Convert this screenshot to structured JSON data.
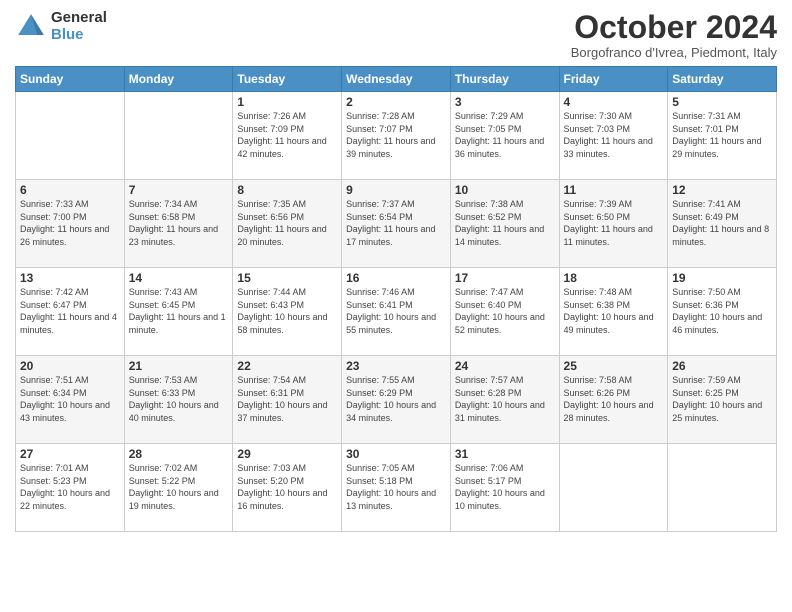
{
  "header": {
    "logo_general": "General",
    "logo_blue": "Blue",
    "month_title": "October 2024",
    "location": "Borgofranco d'Ivrea, Piedmont, Italy"
  },
  "weekdays": [
    "Sunday",
    "Monday",
    "Tuesday",
    "Wednesday",
    "Thursday",
    "Friday",
    "Saturday"
  ],
  "weeks": [
    [
      {
        "day": "",
        "sunrise": "",
        "sunset": "",
        "daylight": ""
      },
      {
        "day": "",
        "sunrise": "",
        "sunset": "",
        "daylight": ""
      },
      {
        "day": "1",
        "sunrise": "Sunrise: 7:26 AM",
        "sunset": "Sunset: 7:09 PM",
        "daylight": "Daylight: 11 hours and 42 minutes."
      },
      {
        "day": "2",
        "sunrise": "Sunrise: 7:28 AM",
        "sunset": "Sunset: 7:07 PM",
        "daylight": "Daylight: 11 hours and 39 minutes."
      },
      {
        "day": "3",
        "sunrise": "Sunrise: 7:29 AM",
        "sunset": "Sunset: 7:05 PM",
        "daylight": "Daylight: 11 hours and 36 minutes."
      },
      {
        "day": "4",
        "sunrise": "Sunrise: 7:30 AM",
        "sunset": "Sunset: 7:03 PM",
        "daylight": "Daylight: 11 hours and 33 minutes."
      },
      {
        "day": "5",
        "sunrise": "Sunrise: 7:31 AM",
        "sunset": "Sunset: 7:01 PM",
        "daylight": "Daylight: 11 hours and 29 minutes."
      }
    ],
    [
      {
        "day": "6",
        "sunrise": "Sunrise: 7:33 AM",
        "sunset": "Sunset: 7:00 PM",
        "daylight": "Daylight: 11 hours and 26 minutes."
      },
      {
        "day": "7",
        "sunrise": "Sunrise: 7:34 AM",
        "sunset": "Sunset: 6:58 PM",
        "daylight": "Daylight: 11 hours and 23 minutes."
      },
      {
        "day": "8",
        "sunrise": "Sunrise: 7:35 AM",
        "sunset": "Sunset: 6:56 PM",
        "daylight": "Daylight: 11 hours and 20 minutes."
      },
      {
        "day": "9",
        "sunrise": "Sunrise: 7:37 AM",
        "sunset": "Sunset: 6:54 PM",
        "daylight": "Daylight: 11 hours and 17 minutes."
      },
      {
        "day": "10",
        "sunrise": "Sunrise: 7:38 AM",
        "sunset": "Sunset: 6:52 PM",
        "daylight": "Daylight: 11 hours and 14 minutes."
      },
      {
        "day": "11",
        "sunrise": "Sunrise: 7:39 AM",
        "sunset": "Sunset: 6:50 PM",
        "daylight": "Daylight: 11 hours and 11 minutes."
      },
      {
        "day": "12",
        "sunrise": "Sunrise: 7:41 AM",
        "sunset": "Sunset: 6:49 PM",
        "daylight": "Daylight: 11 hours and 8 minutes."
      }
    ],
    [
      {
        "day": "13",
        "sunrise": "Sunrise: 7:42 AM",
        "sunset": "Sunset: 6:47 PM",
        "daylight": "Daylight: 11 hours and 4 minutes."
      },
      {
        "day": "14",
        "sunrise": "Sunrise: 7:43 AM",
        "sunset": "Sunset: 6:45 PM",
        "daylight": "Daylight: 11 hours and 1 minute."
      },
      {
        "day": "15",
        "sunrise": "Sunrise: 7:44 AM",
        "sunset": "Sunset: 6:43 PM",
        "daylight": "Daylight: 10 hours and 58 minutes."
      },
      {
        "day": "16",
        "sunrise": "Sunrise: 7:46 AM",
        "sunset": "Sunset: 6:41 PM",
        "daylight": "Daylight: 10 hours and 55 minutes."
      },
      {
        "day": "17",
        "sunrise": "Sunrise: 7:47 AM",
        "sunset": "Sunset: 6:40 PM",
        "daylight": "Daylight: 10 hours and 52 minutes."
      },
      {
        "day": "18",
        "sunrise": "Sunrise: 7:48 AM",
        "sunset": "Sunset: 6:38 PM",
        "daylight": "Daylight: 10 hours and 49 minutes."
      },
      {
        "day": "19",
        "sunrise": "Sunrise: 7:50 AM",
        "sunset": "Sunset: 6:36 PM",
        "daylight": "Daylight: 10 hours and 46 minutes."
      }
    ],
    [
      {
        "day": "20",
        "sunrise": "Sunrise: 7:51 AM",
        "sunset": "Sunset: 6:34 PM",
        "daylight": "Daylight: 10 hours and 43 minutes."
      },
      {
        "day": "21",
        "sunrise": "Sunrise: 7:53 AM",
        "sunset": "Sunset: 6:33 PM",
        "daylight": "Daylight: 10 hours and 40 minutes."
      },
      {
        "day": "22",
        "sunrise": "Sunrise: 7:54 AM",
        "sunset": "Sunset: 6:31 PM",
        "daylight": "Daylight: 10 hours and 37 minutes."
      },
      {
        "day": "23",
        "sunrise": "Sunrise: 7:55 AM",
        "sunset": "Sunset: 6:29 PM",
        "daylight": "Daylight: 10 hours and 34 minutes."
      },
      {
        "day": "24",
        "sunrise": "Sunrise: 7:57 AM",
        "sunset": "Sunset: 6:28 PM",
        "daylight": "Daylight: 10 hours and 31 minutes."
      },
      {
        "day": "25",
        "sunrise": "Sunrise: 7:58 AM",
        "sunset": "Sunset: 6:26 PM",
        "daylight": "Daylight: 10 hours and 28 minutes."
      },
      {
        "day": "26",
        "sunrise": "Sunrise: 7:59 AM",
        "sunset": "Sunset: 6:25 PM",
        "daylight": "Daylight: 10 hours and 25 minutes."
      }
    ],
    [
      {
        "day": "27",
        "sunrise": "Sunrise: 7:01 AM",
        "sunset": "Sunset: 5:23 PM",
        "daylight": "Daylight: 10 hours and 22 minutes."
      },
      {
        "day": "28",
        "sunrise": "Sunrise: 7:02 AM",
        "sunset": "Sunset: 5:22 PM",
        "daylight": "Daylight: 10 hours and 19 minutes."
      },
      {
        "day": "29",
        "sunrise": "Sunrise: 7:03 AM",
        "sunset": "Sunset: 5:20 PM",
        "daylight": "Daylight: 10 hours and 16 minutes."
      },
      {
        "day": "30",
        "sunrise": "Sunrise: 7:05 AM",
        "sunset": "Sunset: 5:18 PM",
        "daylight": "Daylight: 10 hours and 13 minutes."
      },
      {
        "day": "31",
        "sunrise": "Sunrise: 7:06 AM",
        "sunset": "Sunset: 5:17 PM",
        "daylight": "Daylight: 10 hours and 10 minutes."
      },
      {
        "day": "",
        "sunrise": "",
        "sunset": "",
        "daylight": ""
      },
      {
        "day": "",
        "sunrise": "",
        "sunset": "",
        "daylight": ""
      }
    ]
  ]
}
